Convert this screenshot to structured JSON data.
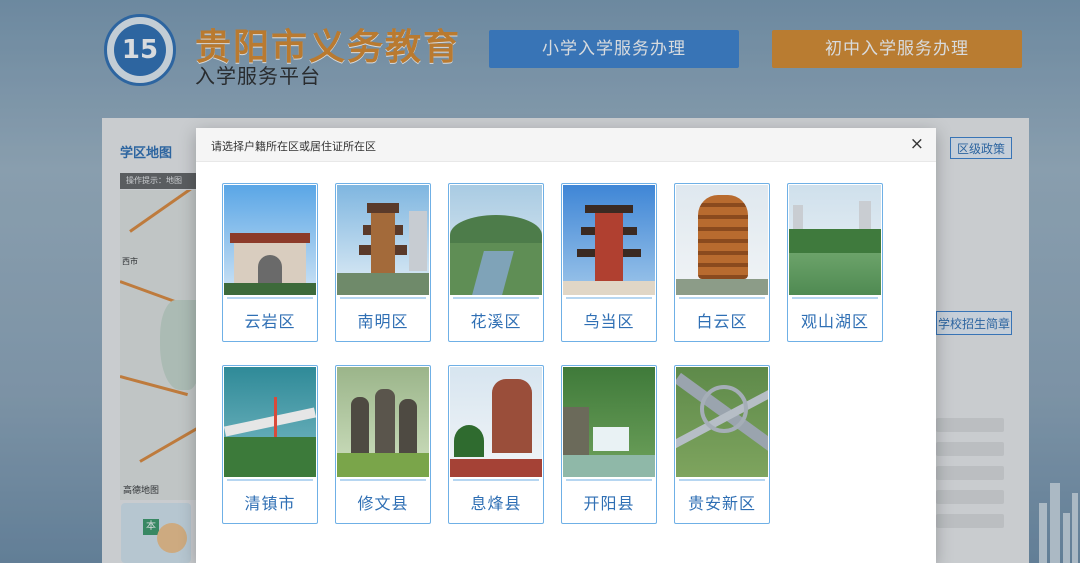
{
  "header": {
    "logo_text": "15",
    "title": "贵阳市义务教育",
    "subtitle": "入学服务平台",
    "primary_button": "小学入学服务办理",
    "middle_button": "初中入学服务办理"
  },
  "background": {
    "map_title": "学区地图",
    "map_hint": "操作提示：地图",
    "map_city": "西市",
    "map_provider": "高德地图",
    "policy_tab": "区级政策",
    "brochure_tab": "学校招生简章",
    "mascot_badge": "本"
  },
  "modal": {
    "title": "请选择户籍所在区或居住证所在区",
    "close": "×",
    "districts": [
      {
        "name": "云岩区",
        "icon": "archway-gate"
      },
      {
        "name": "南明区",
        "icon": "jiaxiu-pavilion"
      },
      {
        "name": "花溪区",
        "icon": "river-valley"
      },
      {
        "name": "乌当区",
        "icon": "pagoda-tower"
      },
      {
        "name": "白云区",
        "icon": "round-tower"
      },
      {
        "name": "观山湖区",
        "icon": "lake-park"
      },
      {
        "name": "清镇市",
        "icon": "bridge-lake"
      },
      {
        "name": "修文县",
        "icon": "statues-garden"
      },
      {
        "name": "息烽县",
        "icon": "monument-sculpture"
      },
      {
        "name": "开阳县",
        "icon": "waterfall"
      },
      {
        "name": "贵安新区",
        "icon": "highway-interchange"
      }
    ]
  },
  "colors": {
    "accent_blue": "#3c82cf",
    "accent_orange": "#d98b2c",
    "district_border": "#6fb0e6",
    "district_text": "#2f6fb4"
  }
}
